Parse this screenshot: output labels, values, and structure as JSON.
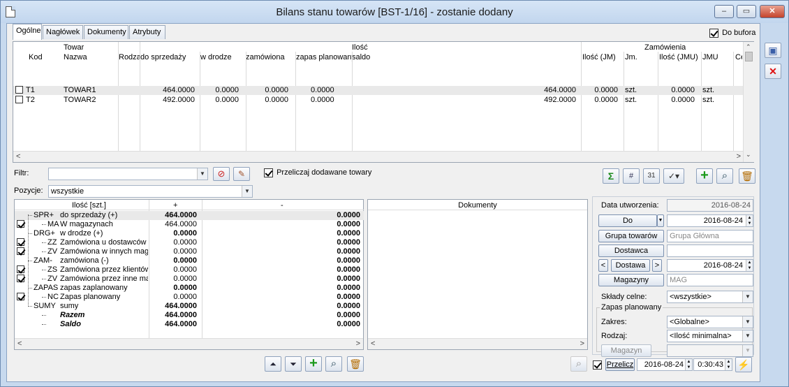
{
  "window": {
    "title": "Bilans stanu towarów [BST-1/16] - zostanie dodany"
  },
  "tabs": [
    "Ogólne",
    "Nagłówek",
    "Dokumenty",
    "Atrybuty"
  ],
  "do_bufora": {
    "label": "Do bufora",
    "checked": true
  },
  "top_grid": {
    "group_towar": "Towar",
    "group_ilosc": "Ilość",
    "group_zamowienia": "Zamówienia",
    "columns": [
      "Kod",
      "Nazwa",
      "Rodza",
      "do sprzedaży",
      "w drodze",
      "zamówiona",
      "zapas planowany",
      "saldo",
      "Ilość (JM)",
      "Jm.",
      "Ilość (JMU)",
      "JMU",
      "Ce"
    ],
    "rows": [
      {
        "kod": "T1",
        "nazwa": "TOWAR1",
        "rodzaj": "",
        "do_sprzedazy": "464.0000",
        "w_drodze": "0.0000",
        "zamowiona": "0.0000",
        "zapas": "0.0000",
        "saldo": "464.0000",
        "ilosc_jm": "0.0000",
        "jm": "szt.",
        "ilosc_jmu": "0.0000",
        "jmu": "szt."
      },
      {
        "kod": "T2",
        "nazwa": "TOWAR2",
        "rodzaj": "",
        "do_sprzedazy": "492.0000",
        "w_drodze": "0.0000",
        "zamowiona": "0.0000",
        "zapas": "0.0000",
        "saldo": "492.0000",
        "ilosc_jm": "0.0000",
        "jm": "szt.",
        "ilosc_jmu": "0.0000",
        "jmu": "szt."
      }
    ]
  },
  "filter": {
    "label": "Filtr:",
    "value": "",
    "przeliczaj_label": "Przeliczaj dodawane towary",
    "przeliczaj_checked": true
  },
  "pozycje": {
    "label": "Pozycje:",
    "value": "wszystkie"
  },
  "tree_grid": {
    "col_ilosc": "Ilość [szt.]",
    "col_plus": "+",
    "col_minus": "-",
    "rows": [
      {
        "check": false,
        "code": "SPR+",
        "name": "do sprzedaży (+)",
        "plus": "464.0000",
        "minus": "0.0000",
        "bold": true,
        "italic": false,
        "level": 0
      },
      {
        "check": true,
        "code": "MA",
        "name": "W magazynach",
        "plus": "464.0000",
        "minus": "0.0000",
        "bold": false,
        "italic": false,
        "level": 1
      },
      {
        "check": false,
        "code": "DRG+",
        "name": "w drodze (+)",
        "plus": "0.0000",
        "minus": "0.0000",
        "bold": true,
        "italic": false,
        "level": 0
      },
      {
        "check": true,
        "code": "ZZ",
        "name": "Zamówiona u dostawców",
        "plus": "0.0000",
        "minus": "0.0000",
        "bold": false,
        "italic": false,
        "level": 1
      },
      {
        "check": true,
        "code": "ZV",
        "name": "Zamówiona w innych magazynach",
        "plus": "0.0000",
        "minus": "0.0000",
        "bold": false,
        "italic": false,
        "level": 1
      },
      {
        "check": false,
        "code": "ZAM-",
        "name": "zamówiona (-)",
        "plus": "0.0000",
        "minus": "0.0000",
        "bold": true,
        "italic": false,
        "level": 0
      },
      {
        "check": true,
        "code": "ZS",
        "name": "Zamówiona przez klientów",
        "plus": "0.0000",
        "minus": "0.0000",
        "bold": false,
        "italic": false,
        "level": 1
      },
      {
        "check": true,
        "code": "ZV",
        "name": "Zamówiona przez inne magazyny",
        "plus": "0.0000",
        "minus": "0.0000",
        "bold": false,
        "italic": false,
        "level": 1
      },
      {
        "check": false,
        "code": "ZAPAS",
        "name": "zapas zaplanowany",
        "plus": "0.0000",
        "minus": "0.0000",
        "bold": true,
        "italic": false,
        "level": 0
      },
      {
        "check": true,
        "code": "NC",
        "name": "Zapas planowany",
        "plus": "0.0000",
        "minus": "0.0000",
        "bold": false,
        "italic": false,
        "level": 1
      },
      {
        "check": false,
        "code": "SUMY",
        "name": "sumy",
        "plus": "464.0000",
        "minus": "0.0000",
        "bold": true,
        "italic": false,
        "level": 0
      },
      {
        "check": false,
        "code": "",
        "name": "Razem",
        "plus": "464.0000",
        "minus": "0.0000",
        "bold": true,
        "italic": true,
        "level": 1
      },
      {
        "check": false,
        "code": "",
        "name": "Saldo",
        "plus": "464.0000",
        "minus": "0.0000",
        "bold": true,
        "italic": true,
        "level": 1
      }
    ]
  },
  "dokumenty_grid": {
    "header": "Dokumenty"
  },
  "right_form": {
    "data_utworzenia_label": "Data utworzenia:",
    "data_utworzenia_value": "2016-08-24",
    "do_label": "Do",
    "do_value": "2016-08-24",
    "grupa_towarow_label": "Grupa towarów",
    "grupa_towarow_value": "Grupa Główna",
    "dostawca_label": "Dostawca",
    "dostawca_value": "",
    "prev_label": "<",
    "dostawa_label": "Dostawa",
    "next_label": ">",
    "dostawa_value": "2016-08-24",
    "magazyny_label": "Magazyny",
    "magazyny_value": "MAG",
    "sklady_label": "Składy celne:",
    "sklady_value": "<wszystkie>",
    "zapas_group_label": "Zapas planowany",
    "zakres_label": "Zakres:",
    "zakres_value": "<Globalne>",
    "rodzaj_label": "Rodzaj:",
    "rodzaj_value": "<Ilość minimalna>",
    "magazyn_label": "Magazyn",
    "magazyn_value": "",
    "przelicz_label": "Przelicz",
    "przelicz_checked": true,
    "przelicz_date": "2016-08-24",
    "przelicz_time": "0:30:43"
  },
  "icons": {
    "sum": "Σ",
    "plus": "+",
    "search": "⌕",
    "trash": "🗑",
    "save": "💾",
    "cancel": "✕",
    "up": "⏶",
    "down": "⏷"
  }
}
